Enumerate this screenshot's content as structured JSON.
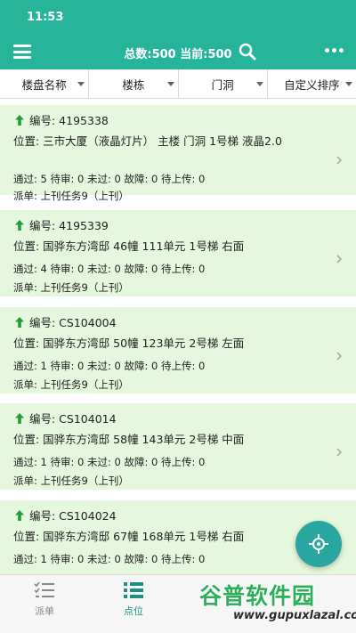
{
  "status_bar": {
    "time": "11:53"
  },
  "app_bar": {
    "title": "总数:500 当前:500",
    "menu_icon": "hamburger-menu-icon",
    "search_icon": "search-icon",
    "more_icon": "more-dots-icon"
  },
  "filters": [
    {
      "label": "楼盘名称"
    },
    {
      "label": "楼栋"
    },
    {
      "label": "门洞"
    },
    {
      "label": "自定义排序"
    }
  ],
  "cards": [
    {
      "id_text": "编号: 4195338",
      "location": "位置: 三市大厦（液晶灯片） 主楼 门洞 1号梯 液晶2.0",
      "stats": "通过: 5 待审: 0 未过: 0 故障: 0 待上传: 0",
      "dispatch": "派单: 上刊任务9（上刊）"
    },
    {
      "id_text": "编号: 4195339",
      "location": "位置: 国骅东方湾邸 46幢 111单元 1号梯 右面",
      "stats": "通过: 4 待审: 0 未过: 0 故障: 0 待上传: 0",
      "dispatch": "派单: 上刊任务9（上刊）"
    },
    {
      "id_text": "编号: CS104004",
      "location": "位置: 国骅东方湾邸 50幢 123单元 2号梯 左面",
      "stats": "通过: 1 待审: 0 未过: 0 故障: 0 待上传: 0",
      "dispatch": "派单: 上刊任务9（上刊）"
    },
    {
      "id_text": "编号: CS104014",
      "location": "位置: 国骅东方湾邸 58幢 143单元 2号梯 中面",
      "stats": "通过: 1 待审: 0 未过: 0 故障: 0 待上传: 0",
      "dispatch": "派单: 上刊任务9（上刊）"
    },
    {
      "id_text": "编号: CS104024",
      "location": "位置: 国骅东方湾邸 67幢 168单元 1号梯 右面",
      "stats": "通过: 1 待审: 0 未过: 0 故障: 0 待上传: 0",
      "dispatch": ""
    }
  ],
  "tabs": [
    {
      "label": "派单",
      "icon": "checklist-icon",
      "active": false
    },
    {
      "label": "点位",
      "icon": "list-icon",
      "active": true
    }
  ],
  "fab": {
    "icon": "locate-crosshair-icon"
  },
  "watermark": {
    "logo": "谷普软件园",
    "url": "www.gupuxlazal.com"
  },
  "colors": {
    "primary": "#26b49a",
    "card_bg": "#e5f7dc",
    "arrow": "#1e9e3a",
    "fab": "#2aa6a0",
    "tab_active": "#1a8f82",
    "tab_inactive": "#888888"
  }
}
